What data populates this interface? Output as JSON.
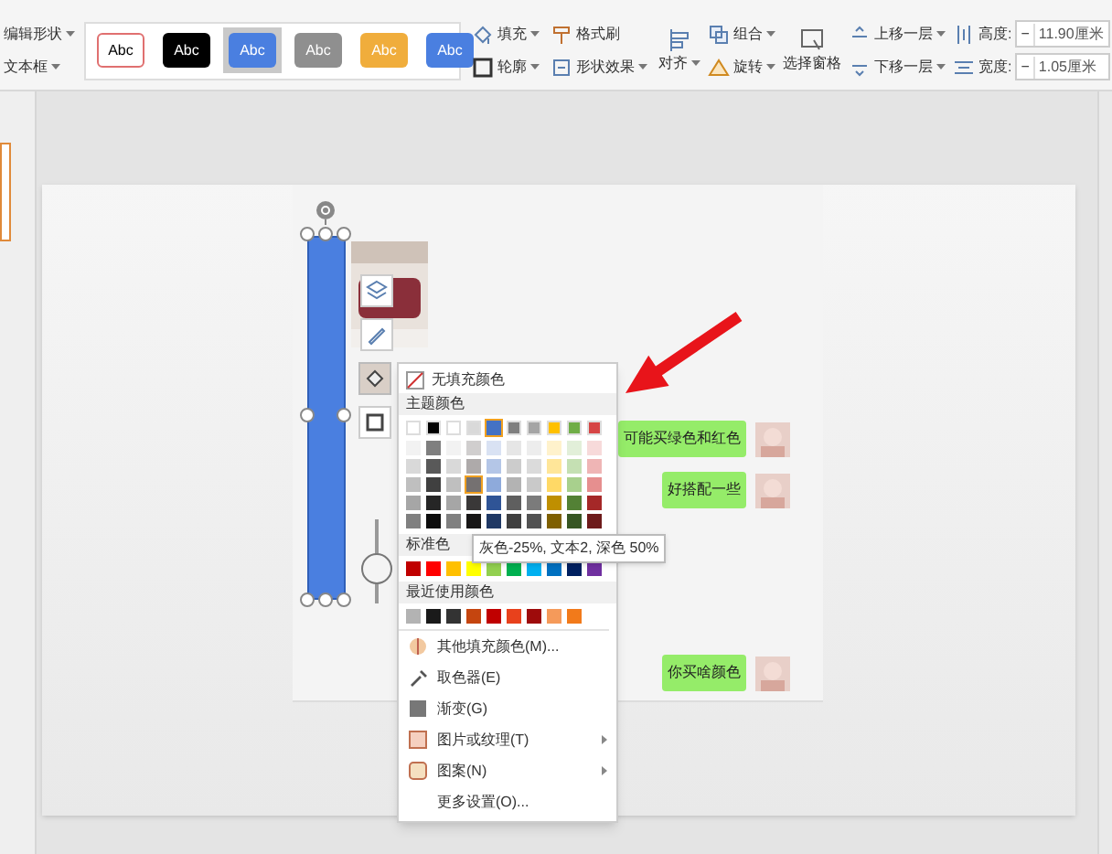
{
  "ribbon": {
    "left": [
      {
        "label": "编辑形状",
        "dropdown": true
      },
      {
        "label": "文本框",
        "dropdown": true
      }
    ],
    "styles": [
      {
        "label": "Abc",
        "kind": "outline",
        "color": "#ffffff",
        "selected": false
      },
      {
        "label": "Abc",
        "kind": "filled",
        "color": "#000000",
        "selected": false
      },
      {
        "label": "Abc",
        "kind": "filled",
        "color": "#4a7fe0",
        "selected": true
      },
      {
        "label": "Abc",
        "kind": "filled",
        "color": "#8f8f8f",
        "selected": false
      },
      {
        "label": "Abc",
        "kind": "filled",
        "color": "#f0ad3c",
        "selected": false
      },
      {
        "label": "Abc",
        "kind": "filled",
        "color": "#4a7fe0",
        "selected": false
      }
    ],
    "small_buttons": [
      [
        {
          "label": "填充",
          "kind": "fill",
          "dropdown": true
        },
        {
          "label": "轮廓",
          "kind": "outline",
          "dropdown": true
        }
      ],
      [
        {
          "label": "格式刷",
          "kind": "brush",
          "dropdown": false
        },
        {
          "label": "形状效果",
          "kind": "effect",
          "dropdown": true
        }
      ]
    ],
    "align": {
      "label": "对齐",
      "dropdown": true
    },
    "arrange": [
      {
        "label": "组合",
        "kind": "group",
        "dropdown": true
      },
      {
        "label": "旋转",
        "kind": "rotate",
        "dropdown": true
      }
    ],
    "pane": {
      "label": "选择窗格"
    },
    "layers": [
      {
        "label": "上移一层",
        "kind": "up",
        "dropdown": true
      },
      {
        "label": "下移一层",
        "kind": "down",
        "dropdown": true
      }
    ],
    "sizes": [
      {
        "label": "高度:",
        "kind": "height",
        "minus": "−",
        "value": "11.90厘米"
      },
      {
        "label": "宽度:",
        "kind": "width",
        "minus": "−",
        "value": "1.05厘米"
      }
    ]
  },
  "chat": [
    {
      "text": "可能买绿色和红色",
      "kind": "top"
    },
    {
      "text": "好搭配一些",
      "kind": "top"
    },
    {
      "text": "你买啥颜色",
      "kind": "bottom"
    }
  ],
  "color_menu": {
    "no_fill": "无填充颜色",
    "theme_label": "主题颜色",
    "theme": [
      {
        "color": "#ffffff",
        "selected": false
      },
      {
        "color": "#000000",
        "selected": false
      },
      {
        "color": "#ffffff",
        "selected": false
      },
      {
        "color": "#d9d9d9",
        "selected": false
      },
      {
        "color": "#4472c4",
        "selected": true
      },
      {
        "color": "#7f7f7f",
        "selected": false
      },
      {
        "color": "#a5a5a5",
        "selected": false
      },
      {
        "color": "#ffc000",
        "selected": false
      },
      {
        "color": "#70ad47",
        "selected": false
      },
      {
        "color": "#d64545",
        "selected": false
      }
    ],
    "shades": [
      [
        {
          "color": "#f2f2f2",
          "hovered": false
        },
        {
          "color": "#7f7f7f",
          "hovered": false
        },
        {
          "color": "#f2f2f2",
          "hovered": false
        },
        {
          "color": "#d0cece",
          "hovered": false
        },
        {
          "color": "#d9e2f3",
          "hovered": false
        },
        {
          "color": "#e6e6e6",
          "hovered": false
        },
        {
          "color": "#ededed",
          "hovered": false
        },
        {
          "color": "#fff2cc",
          "hovered": false
        },
        {
          "color": "#e2efd9",
          "hovered": false
        },
        {
          "color": "#f7dada",
          "hovered": false
        }
      ],
      [
        {
          "color": "#d9d9d9",
          "hovered": false
        },
        {
          "color": "#595959",
          "hovered": false
        },
        {
          "color": "#d9d9d9",
          "hovered": false
        },
        {
          "color": "#aeaaaa",
          "hovered": false
        },
        {
          "color": "#b4c6e7",
          "hovered": false
        },
        {
          "color": "#cccccc",
          "hovered": false
        },
        {
          "color": "#dbdbdb",
          "hovered": false
        },
        {
          "color": "#ffe699",
          "hovered": false
        },
        {
          "color": "#c5e0b3",
          "hovered": false
        },
        {
          "color": "#efb5b5",
          "hovered": false
        }
      ],
      [
        {
          "color": "#bfbfbf",
          "hovered": false
        },
        {
          "color": "#404040",
          "hovered": false
        },
        {
          "color": "#bfbfbf",
          "hovered": false
        },
        {
          "color": "#757171",
          "hovered": true
        },
        {
          "color": "#8eaadb",
          "hovered": false
        },
        {
          "color": "#b3b3b3",
          "hovered": false
        },
        {
          "color": "#c9c9c9",
          "hovered": false
        },
        {
          "color": "#ffd966",
          "hovered": false
        },
        {
          "color": "#a8d08d",
          "hovered": false
        },
        {
          "color": "#e68f8f",
          "hovered": false
        }
      ],
      [
        {
          "color": "#a6a6a6",
          "hovered": false
        },
        {
          "color": "#262626",
          "hovered": false
        },
        {
          "color": "#a6a6a6",
          "hovered": false
        },
        {
          "color": "#3a3838",
          "hovered": false
        },
        {
          "color": "#2f5496",
          "hovered": false
        },
        {
          "color": "#5f5f5f",
          "hovered": false
        },
        {
          "color": "#7b7b7b",
          "hovered": false
        },
        {
          "color": "#bf8f00",
          "hovered": false
        },
        {
          "color": "#538135",
          "hovered": false
        },
        {
          "color": "#a52828",
          "hovered": false
        }
      ],
      [
        {
          "color": "#808080",
          "hovered": false
        },
        {
          "color": "#0d0d0d",
          "hovered": false
        },
        {
          "color": "#808080",
          "hovered": false
        },
        {
          "color": "#171616",
          "hovered": false
        },
        {
          "color": "#1f3864",
          "hovered": false
        },
        {
          "color": "#3f3f3f",
          "hovered": false
        },
        {
          "color": "#525252",
          "hovered": false
        },
        {
          "color": "#7f6000",
          "hovered": false
        },
        {
          "color": "#375623",
          "hovered": false
        },
        {
          "color": "#6e1b1b",
          "hovered": false
        }
      ]
    ],
    "tooltip": "灰色-25%, 文本2, 深色 50%",
    "standard_label": "标准色",
    "standard": [
      {
        "color": "#c00000"
      },
      {
        "color": "#ff0000"
      },
      {
        "color": "#ffc000"
      },
      {
        "color": "#ffff00"
      },
      {
        "color": "#92d050"
      },
      {
        "color": "#00b050"
      },
      {
        "color": "#00b0f0"
      },
      {
        "color": "#0070c0"
      },
      {
        "color": "#002060"
      },
      {
        "color": "#7030a0"
      }
    ],
    "recent_label": "最近使用颜色",
    "recent": [
      {
        "color": "#b3b3b3"
      },
      {
        "color": "#1a1a1a"
      },
      {
        "color": "#333333"
      },
      {
        "color": "#c5450f"
      },
      {
        "color": "#c00000"
      },
      {
        "color": "#e8411c"
      },
      {
        "color": "#9e0b0b"
      },
      {
        "color": "#f59a5a"
      },
      {
        "color": "#f27a1a"
      }
    ],
    "items": [
      {
        "label": "其他填充颜色(M)...",
        "kind": "palette",
        "submenu": false
      },
      {
        "label": "取色器(E)",
        "kind": "picker",
        "submenu": false
      },
      {
        "label": "渐变(G)",
        "kind": "gradient",
        "submenu": false
      },
      {
        "label": "图片或纹理(T)",
        "kind": "texture",
        "submenu": true
      },
      {
        "label": "图案(N)",
        "kind": "pattern",
        "submenu": true
      },
      {
        "label": "更多设置(O)...",
        "kind": "none",
        "submenu": false
      }
    ]
  }
}
